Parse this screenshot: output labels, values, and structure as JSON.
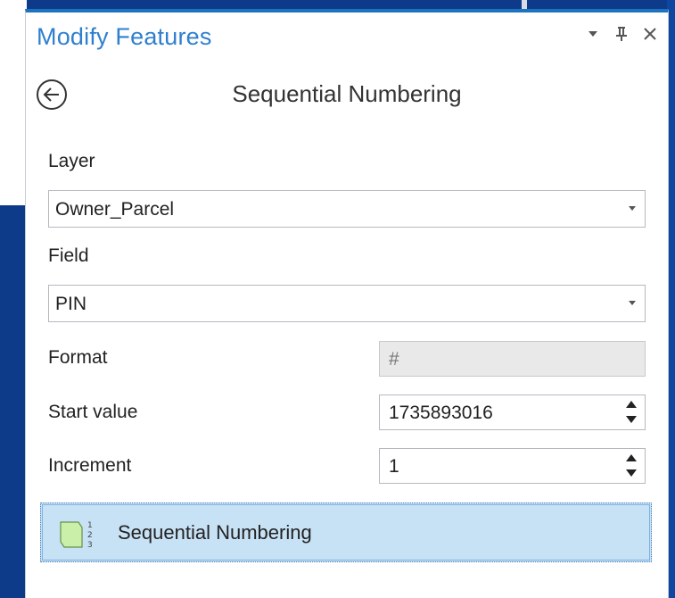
{
  "pane": {
    "title": "Modify Features",
    "controls": [
      "dropdown-arrow-icon",
      "pin-icon",
      "close-icon"
    ]
  },
  "tool": {
    "title": "Sequential Numbering",
    "back_icon": "back-arrow-icon"
  },
  "form": {
    "layer_label": "Layer",
    "layer_value": "Owner_Parcel",
    "field_label": "Field",
    "field_value": "PIN",
    "format_label": "Format",
    "format_value": "#",
    "start_label": "Start value",
    "start_value": "1735893016",
    "increment_label": "Increment",
    "increment_value": "1"
  },
  "tool_list": {
    "item_label": "Sequential Numbering",
    "item_icon": "sequential-numbering-icon"
  },
  "colors": {
    "accent": "#1e73be",
    "title_blue": "#2f7fcf",
    "selection": "#c7e1f5",
    "background": "#0e3a8a"
  }
}
